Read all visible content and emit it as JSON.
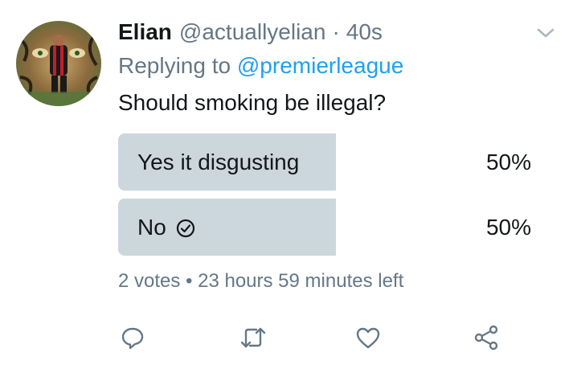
{
  "tweet": {
    "name": "Elian",
    "handle": "@actuallyelian",
    "separator": "·",
    "time": "40s",
    "reply_prefix": "Replying to",
    "reply_handle": "@premierleague",
    "text": "Should smoking be illegal?"
  },
  "poll": {
    "options": [
      {
        "label": "Yes it disgusting",
        "percent": "50%",
        "fill_fraction": 0.5,
        "selected": false
      },
      {
        "label": "No",
        "percent": "50%",
        "fill_fraction": 0.5,
        "selected": true
      }
    ],
    "meta": "2 votes • 23 hours 59 minutes left"
  },
  "icons": {
    "caret": "chevron-down-icon",
    "selected": "check-circle-icon",
    "reply": "reply-icon",
    "retweet": "retweet-icon",
    "like": "heart-icon",
    "share": "share-icon"
  },
  "colors": {
    "text": "#14171a",
    "muted": "#657786",
    "link": "#1da1f2",
    "poll_bar": "#ccd6dd"
  }
}
